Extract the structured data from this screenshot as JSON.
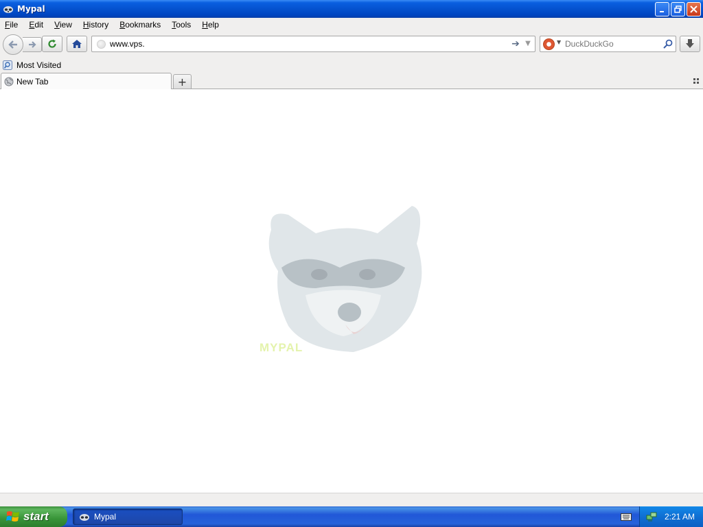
{
  "window": {
    "title": "Mypal"
  },
  "menu": [
    "File",
    "Edit",
    "View",
    "History",
    "Bookmarks",
    "Tools",
    "Help"
  ],
  "menu_mnemonics": [
    "F",
    "E",
    "V",
    "H",
    "B",
    "T",
    "H"
  ],
  "url_bar": {
    "value": "www.vps."
  },
  "search_bar": {
    "placeholder": "DuckDuckGo"
  },
  "bookmarks": {
    "items": [
      {
        "label": "Most Visited"
      }
    ]
  },
  "tabs": [
    {
      "label": "New Tab",
      "active": true
    }
  ],
  "content": {
    "brand_text": "MYPAL"
  },
  "taskbar": {
    "start_label": "start",
    "tasks": [
      {
        "label": "Mypal"
      }
    ],
    "clock": "2:21 AM"
  },
  "colors": {
    "titlebar": "#0552cf",
    "start_green": "#389438",
    "taskbar_blue": "#2157d7"
  }
}
